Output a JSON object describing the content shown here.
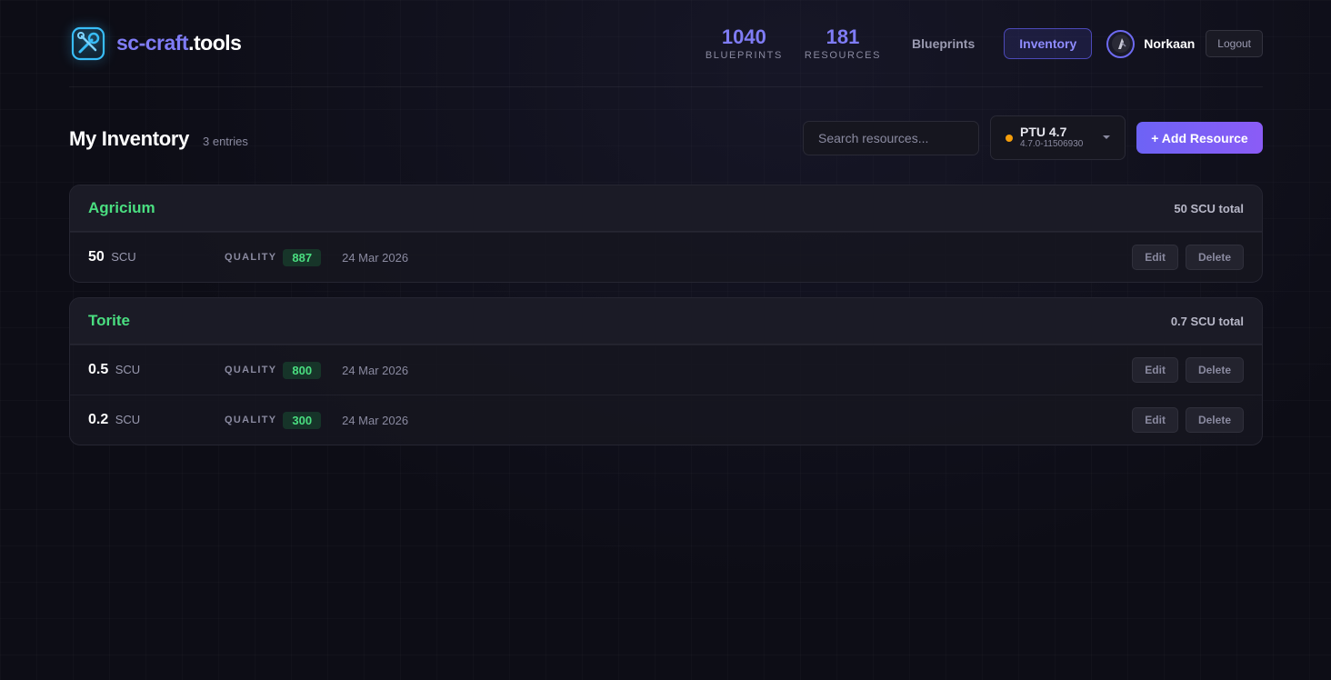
{
  "header": {
    "logo_part1": "sc-craft",
    "logo_part2": ".tools",
    "stats": [
      {
        "value": "1040",
        "label": "BLUEPRINTS"
      },
      {
        "value": "181",
        "label": "RESOURCES"
      }
    ],
    "nav_blueprints": "Blueprints",
    "nav_inventory": "Inventory",
    "username": "Norkaan",
    "logout_label": "Logout"
  },
  "toolbar": {
    "title": "My Inventory",
    "entries": "3 entries",
    "search_placeholder": "Search resources...",
    "version_main": "PTU 4.7",
    "version_sub": "4.7.0-11506930",
    "add_label": "+ Add Resource"
  },
  "groups": [
    {
      "name": "Agricium",
      "total": "50 SCU total",
      "rows": [
        {
          "amount": "50",
          "unit": "SCU",
          "quality_label": "QUALITY",
          "quality": "887",
          "date": "24 Mar 2026",
          "edit": "Edit",
          "delete": "Delete"
        }
      ]
    },
    {
      "name": "Torite",
      "total": "0.7 SCU total",
      "rows": [
        {
          "amount": "0.5",
          "unit": "SCU",
          "quality_label": "QUALITY",
          "quality": "800",
          "date": "24 Mar 2026",
          "edit": "Edit",
          "delete": "Delete"
        },
        {
          "amount": "0.2",
          "unit": "SCU",
          "quality_label": "QUALITY",
          "quality": "300",
          "date": "24 Mar 2026",
          "edit": "Edit",
          "delete": "Delete"
        }
      ]
    }
  ],
  "colors": {
    "accent": "#7f7cf5",
    "resource_green": "#4ade80",
    "status_dot": "#f59e0b"
  }
}
